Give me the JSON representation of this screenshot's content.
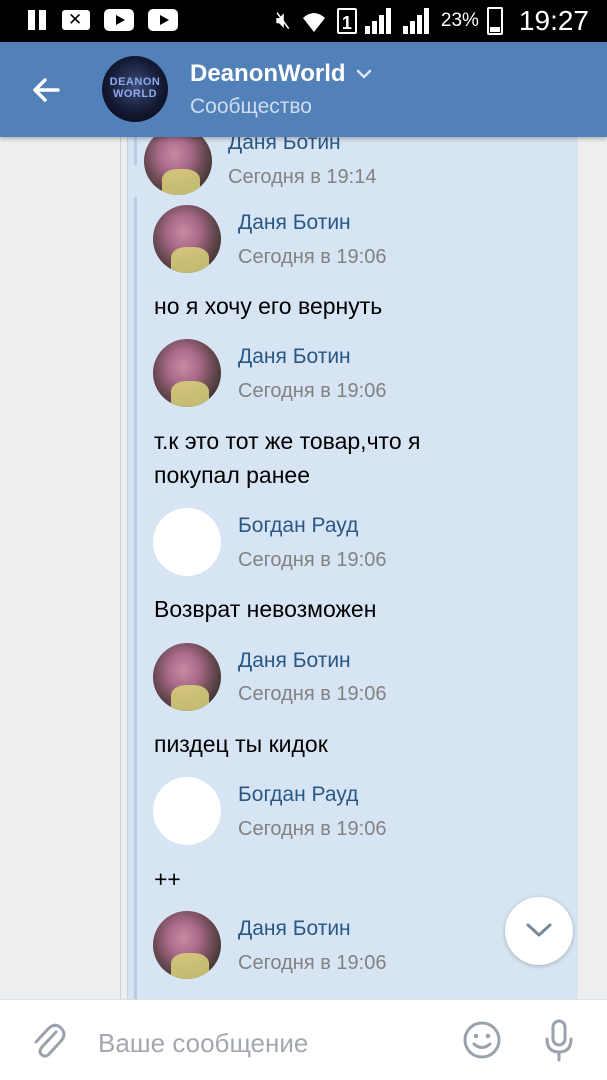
{
  "status_bar": {
    "battery_percent": "23%",
    "time": "19:27",
    "sim_slot": "1",
    "icons": [
      "pause-icon",
      "mail-icon",
      "youtube-icon",
      "youtube-icon",
      "mute-icon",
      "wifi-icon",
      "sim-icon",
      "signal-icon",
      "battery-icon"
    ]
  },
  "header": {
    "title": "DeanonWorld",
    "subtitle": "Сообщество",
    "avatar_text": "DEANON WORLD",
    "back_icon": "arrow-left-icon",
    "dropdown_icon": "chevron-down-icon"
  },
  "forwarded": {
    "top": {
      "author": "Даня Ботин",
      "time": "Сегодня в 19:14"
    },
    "messages": [
      {
        "author": "Даня Ботин",
        "time": "Сегодня в 19:06",
        "text": "но я хочу его вернуть",
        "avatar": "photo"
      },
      {
        "author": "Даня Ботин",
        "time": "Сегодня в 19:06",
        "text": "т.к это тот же товар,что я покупал ранее",
        "avatar": "photo"
      },
      {
        "author": "Богдан Рауд",
        "time": "Сегодня в 19:06",
        "text": "Возврат невозможен",
        "avatar": "blank"
      },
      {
        "author": "Даня Ботин",
        "time": "Сегодня в 19:06",
        "text": "пиздец ты кидок",
        "avatar": "photo"
      },
      {
        "author": "Богдан Рауд",
        "time": "Сегодня в 19:06",
        "text": "++",
        "avatar": "blank"
      },
      {
        "author": "Даня Ботин",
        "time": "Сегодня в 19:06",
        "text": "",
        "avatar": "photo"
      }
    ]
  },
  "composer": {
    "placeholder": "Ваше сообщение",
    "icons": [
      "paperclip-icon",
      "emoji-icon",
      "mic-icon"
    ]
  },
  "colors": {
    "header_bg": "#5181b8",
    "forward_bg": "#d6e4f3",
    "name_color": "#2a5885",
    "time_color": "#828282"
  }
}
